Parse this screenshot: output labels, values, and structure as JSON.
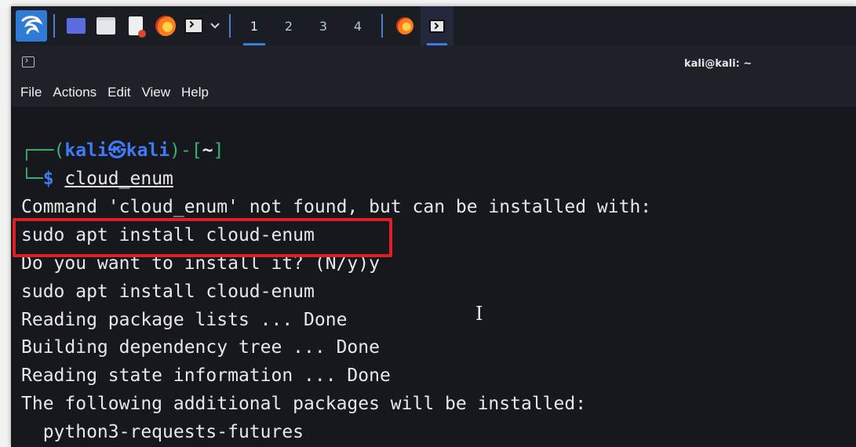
{
  "taskbar": {
    "workspaces": [
      "1",
      "2",
      "3",
      "4"
    ],
    "active_workspace": "1"
  },
  "window": {
    "title": "kali@kali: ~"
  },
  "menu": [
    "File",
    "Actions",
    "Edit",
    "View",
    "Help"
  ],
  "terminal": {
    "prompt": {
      "open": "┌──(",
      "user": "kali",
      "at": "㉿",
      "host": "kali",
      "mid": ")-[",
      "path": "~",
      "close": "]",
      "corner": "└─",
      "dollar": "$",
      "command": "cloud_enum"
    },
    "lines": [
      "Command 'cloud_enum' not found, but can be installed with:",
      "sudo apt install cloud-enum",
      "Do you want to install it? (N/y)y",
      "sudo apt install cloud-enum",
      "Reading package lists ... Done",
      "Building dependency tree ... Done",
      "Reading state information ... Done",
      "The following additional packages will be installed:",
      "  python3-requests-futures"
    ]
  },
  "colors": {
    "highlight_box": "#dd1f26",
    "prompt_blue": "#3f7bf5",
    "prompt_green": "#3bb26b"
  },
  "icons": [
    "kali-dragon-icon",
    "show-desktop-icon",
    "file-manager-icon",
    "text-editor-icon",
    "firefox-icon",
    "terminal-icon",
    "chevron-down-icon"
  ]
}
